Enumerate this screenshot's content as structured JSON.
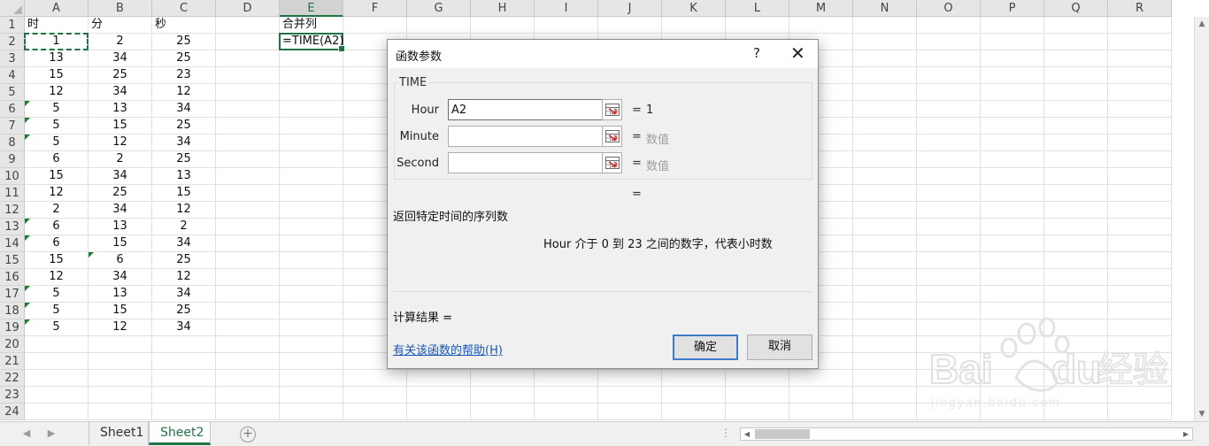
{
  "sheet": {
    "columns": [
      "A",
      "B",
      "C",
      "D",
      "E",
      "F",
      "G",
      "H",
      "I",
      "J",
      "K",
      "L",
      "M",
      "N",
      "O",
      "P",
      "Q",
      "R"
    ],
    "active_column": "E",
    "rows": [
      "1",
      "2",
      "3",
      "4",
      "5",
      "6",
      "7",
      "8",
      "9",
      "10",
      "11",
      "12",
      "13",
      "14",
      "15",
      "16",
      "17",
      "18",
      "19",
      "20",
      "21",
      "22",
      "23",
      "24"
    ],
    "headers": {
      "A1": "时",
      "B1": "分",
      "C1": "秒",
      "E1": "合并列"
    },
    "data": [
      [
        "1",
        "2",
        "25"
      ],
      [
        "13",
        "34",
        "25"
      ],
      [
        "15",
        "25",
        "23"
      ],
      [
        "12",
        "34",
        "12"
      ],
      [
        "5",
        "13",
        "34"
      ],
      [
        "5",
        "15",
        "25"
      ],
      [
        "5",
        "12",
        "34"
      ],
      [
        "6",
        "2",
        "25"
      ],
      [
        "15",
        "34",
        "13"
      ],
      [
        "12",
        "25",
        "15"
      ],
      [
        "2",
        "34",
        "12"
      ],
      [
        "6",
        "13",
        "2"
      ],
      [
        "6",
        "15",
        "34"
      ],
      [
        "15",
        "6",
        "25"
      ],
      [
        "12",
        "34",
        "12"
      ],
      [
        "5",
        "13",
        "34"
      ],
      [
        "5",
        "15",
        "25"
      ],
      [
        "5",
        "12",
        "34"
      ]
    ],
    "formula_cell": "=TIME(A2)",
    "marker_color": "#1e7a34",
    "accent_color": "#217346"
  },
  "tabs": {
    "items": [
      "Sheet1",
      "Sheet2"
    ],
    "active": "Sheet2"
  },
  "dialog": {
    "title": "函数参数",
    "help_glyph": "?",
    "close_glyph": "✕",
    "function_name": "TIME",
    "args": [
      {
        "label": "Hour",
        "value": "A2",
        "result": "1",
        "is_hint": false
      },
      {
        "label": "Minute",
        "value": "",
        "result": "数值",
        "is_hint": true
      },
      {
        "label": "Second",
        "value": "",
        "result": "数值",
        "is_hint": true
      }
    ],
    "equals": "=",
    "result_equals": "=",
    "description": "返回特定时间的序列数",
    "arg_description": "Hour  介于 0 到 23 之间的数字，代表小时数",
    "calc_result_label": "计算结果 =",
    "help_link": "有关该函数的帮助(H)",
    "ok_label": "确定",
    "cancel_label": "取消"
  },
  "watermark": {
    "text": "jingyan.baidu.com",
    "brand_latin": "Bai",
    "brand_latin_2": "du",
    "brand_cjk": "经验"
  }
}
